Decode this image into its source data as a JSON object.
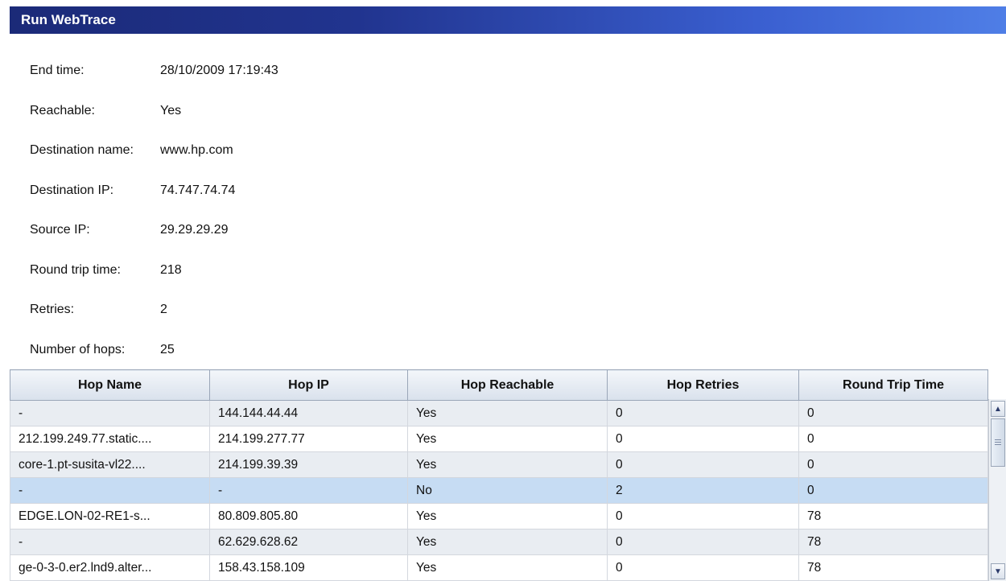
{
  "title": "Run WebTrace",
  "details": [
    {
      "label": "End time:",
      "value": "28/10/2009 17:19:43"
    },
    {
      "label": "Reachable:",
      "value": "Yes"
    },
    {
      "label": "Destination name:",
      "value": "www.hp.com"
    },
    {
      "label": "Destination IP:",
      "value": "74.747.74.74"
    },
    {
      "label": "Source IP:",
      "value": "29.29.29.29"
    },
    {
      "label": "Round trip time:",
      "value": "218"
    },
    {
      "label": "Retries:",
      "value": "2"
    },
    {
      "label": "Number of hops:",
      "value": "25"
    }
  ],
  "table": {
    "columns": [
      "Hop Name",
      "Hop IP",
      "Hop Reachable",
      "Hop Retries",
      "Round Trip Time"
    ],
    "rows": [
      [
        "-",
        "144.144.44.44",
        "Yes",
        "0",
        "0"
      ],
      [
        "212.199.249.77.static....",
        "214.199.277.77",
        "Yes",
        "0",
        "0"
      ],
      [
        "core-1.pt-susita-vl22....",
        "214.199.39.39",
        "Yes",
        "0",
        "0"
      ],
      [
        "-",
        "-",
        "No",
        "2",
        "0"
      ],
      [
        "EDGE.LON-02-RE1-s...",
        "80.809.805.80",
        "Yes",
        "0",
        "78"
      ],
      [
        "-",
        "62.629.628.62",
        "Yes",
        "0",
        "78"
      ],
      [
        "ge-0-3-0.er2.lnd9.alter...",
        "158.43.158.109",
        "Yes",
        "0",
        "78"
      ]
    ],
    "selected_row": 3
  },
  "icons": {
    "scroll_up": "scroll-up-arrow-icon",
    "scroll_down": "scroll-down-arrow-icon"
  }
}
